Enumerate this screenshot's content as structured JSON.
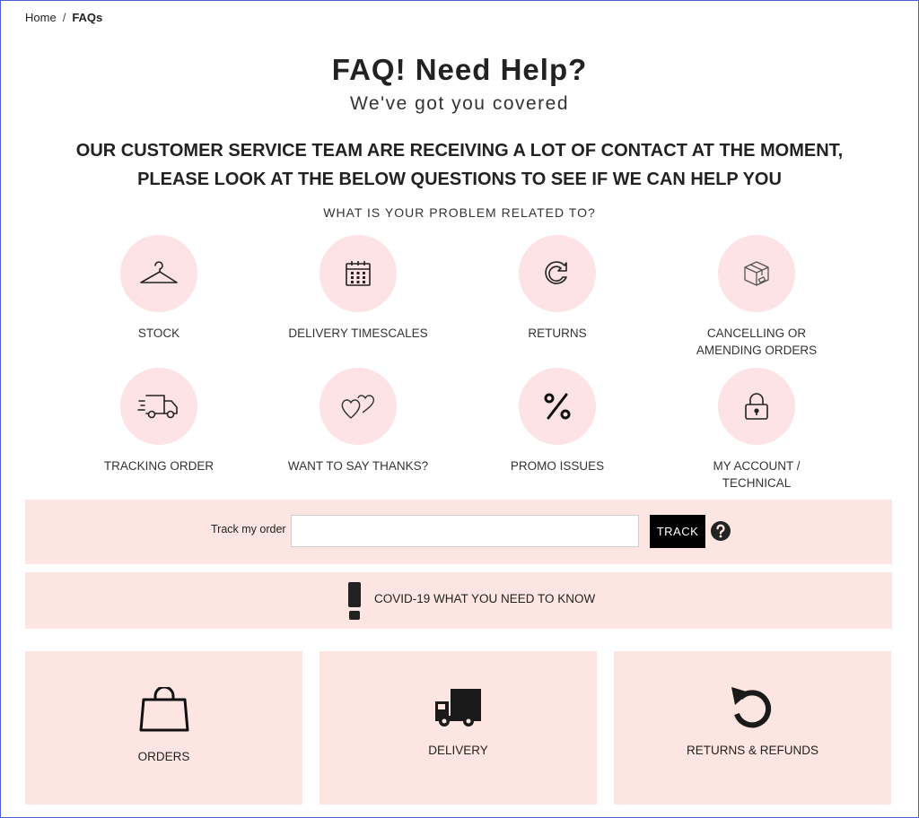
{
  "breadcrumb": {
    "home": "Home",
    "separator": "/",
    "current": "FAQs"
  },
  "hero": {
    "title": "FAQ! Need Help?",
    "subtitle": "We've got you covered"
  },
  "notice": {
    "line1": "OUR CUSTOMER SERVICE TEAM ARE RECEIVING A LOT OF CONTACT AT THE MOMENT,",
    "line2": "PLEASE LOOK AT THE BELOW QUESTIONS TO SEE IF WE CAN HELP YOU"
  },
  "prompt": "WHAT IS YOUR PROBLEM RELATED TO?",
  "categories": [
    {
      "label": "STOCK",
      "icon": "hanger-icon"
    },
    {
      "label": "DELIVERY TIMESCALES",
      "icon": "calendar-icon"
    },
    {
      "label": "RETURNS",
      "icon": "return-arrow-icon"
    },
    {
      "label_line1": "CANCELLING OR",
      "label_line2": "AMENDING ORDERS",
      "icon": "box-icon"
    },
    {
      "label": "TRACKING ORDER",
      "icon": "delivery-truck-icon"
    },
    {
      "label": "WANT TO SAY THANKS?",
      "icon": "hearts-icon"
    },
    {
      "label": "PROMO ISSUES",
      "icon": "percent-icon"
    },
    {
      "label_line1": "MY ACCOUNT /",
      "label_line2": "TECHNICAL",
      "icon": "lock-icon"
    }
  ],
  "track": {
    "label": "Track my order",
    "input_value": "",
    "input_placeholder": "",
    "button": "TRACK",
    "help_icon": "question-icon"
  },
  "covid": {
    "text": "COVID-19 WHAT YOU NEED TO KNOW",
    "icon": "exclamation-icon"
  },
  "tiles": [
    {
      "label": "ORDERS",
      "icon": "shopping-bag-icon"
    },
    {
      "label": "DELIVERY",
      "icon": "truck-icon"
    },
    {
      "label": "RETURNS & REFUNDS",
      "icon": "undo-icon"
    }
  ],
  "colors": {
    "circle_bg": "#fde2e6",
    "panel_bg": "#fde6e1",
    "button_bg": "#000000",
    "frame_border": "#4a5fd6"
  }
}
